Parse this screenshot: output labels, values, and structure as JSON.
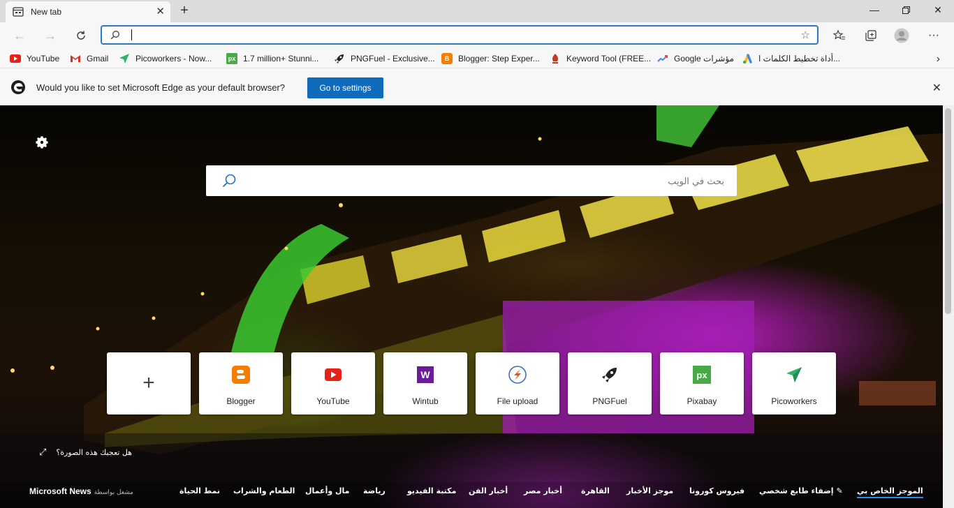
{
  "browser": {
    "tab": {
      "title": "New tab"
    },
    "address": {
      "value": "",
      "placeholder": ""
    },
    "favorites": [
      {
        "label": "YouTube",
        "icon": "youtube-icon"
      },
      {
        "label": "Gmail",
        "icon": "gmail-icon"
      },
      {
        "label": "Picoworkers - Now...",
        "icon": "picoworkers-icon"
      },
      {
        "label": "1.7 million+ Stunni...",
        "icon": "pixabay-icon"
      },
      {
        "label": "PNGFuel - Exclusive...",
        "icon": "pngfuel-icon"
      },
      {
        "label": "Blogger: Step Exper...",
        "icon": "blogger-icon"
      },
      {
        "label": "Keyword Tool (FREE...",
        "icon": "keywordtool-icon"
      },
      {
        "label": "Google مؤشرات",
        "icon": "google-trends-icon"
      },
      {
        "label": "أداة تخطيط الكلمات ا...",
        "icon": "google-ads-icon"
      }
    ]
  },
  "infobar": {
    "message": "Would you like to set Microsoft Edge as your default browser?",
    "button": "Go to settings"
  },
  "newtab": {
    "search_placeholder": "بحث في الويب",
    "quick_links": [
      {
        "label": "Blogger",
        "icon": "blogger-icon"
      },
      {
        "label": "YouTube",
        "icon": "youtube-icon"
      },
      {
        "label": "Wintub",
        "icon": "wintub-icon"
      },
      {
        "label": "File upload",
        "icon": "file-upload-icon"
      },
      {
        "label": "PNGFuel",
        "icon": "pngfuel-icon"
      },
      {
        "label": "Pixabay",
        "icon": "pixabay-icon"
      },
      {
        "label": "Picoworkers",
        "icon": "picoworkers-icon"
      }
    ],
    "like_image": "هل تعجبك هذه الصورة؟",
    "news": {
      "provider": "Microsoft News",
      "provided_by": "مشغل بواسطة",
      "categories": [
        "الموجز الخاص بي",
        "إضفاء طابع شخصي",
        "فيروس كورونا",
        "موجز الأخبار",
        "القاهرة",
        "أخبار مصر",
        "أخبار الفن",
        "مكتبة الفيديو",
        "رياضة",
        "مال وأعمال",
        "الطعام والشراب",
        "نمط الحياة"
      ]
    }
  },
  "colors": {
    "accent": "#0f6cbd",
    "focus": "#2b77c9",
    "newsUnderline": "#2b8ef0"
  }
}
